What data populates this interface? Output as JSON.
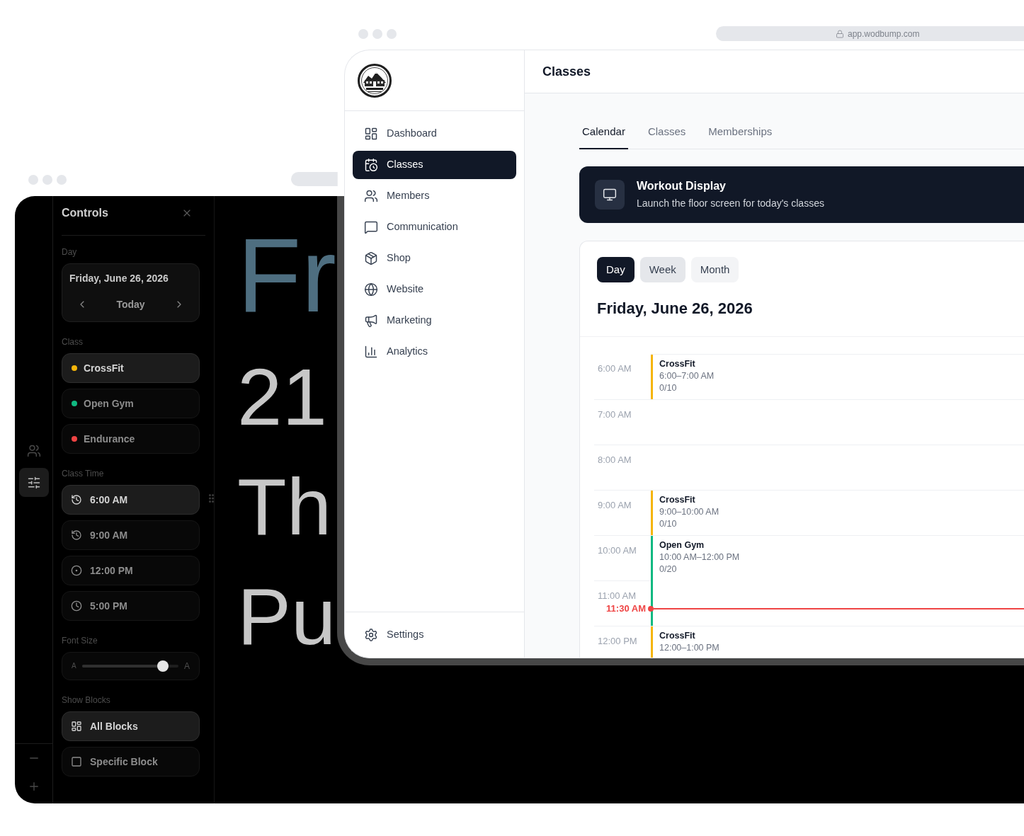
{
  "back_window": {
    "rail_tabs": [
      {
        "selected": false
      },
      {
        "selected": true
      }
    ],
    "controls": {
      "title": "Controls",
      "day": {
        "label": "Day",
        "date": "Friday, June 26, 2026",
        "today": "Today"
      },
      "class": {
        "label": "Class",
        "options": [
          {
            "name": "CrossFit",
            "color": "#f5b50a",
            "selected": true
          },
          {
            "name": "Open Gym",
            "color": "#10b981",
            "selected": false
          },
          {
            "name": "Endurance",
            "color": "#ef4444",
            "selected": false
          }
        ]
      },
      "class_time": {
        "label": "Class Time",
        "options": [
          {
            "time": "6:00 AM",
            "selected": true
          },
          {
            "time": "9:00 AM",
            "selected": false
          },
          {
            "time": "12:00 PM",
            "selected": false
          },
          {
            "time": "5:00 PM",
            "selected": false
          }
        ]
      },
      "font_size": {
        "label": "Font Size",
        "min_label": "A",
        "max_label": "A",
        "level": 0.84
      },
      "show_blocks": {
        "label": "Show Blocks",
        "options": [
          {
            "label": "All Blocks",
            "selected": true
          },
          {
            "label": "Specific Block",
            "selected": false
          }
        ]
      }
    },
    "display": {
      "lines": [
        {
          "kind": "heading",
          "text": "Fr"
        },
        {
          "kind": "body",
          "text": "21"
        },
        {
          "kind": "body",
          "text": "Th"
        },
        {
          "kind": "body",
          "text": "Pu"
        }
      ]
    }
  },
  "front_window": {
    "address": "app.wodbump.com",
    "sidebar": {
      "items": [
        {
          "label": "Dashboard",
          "selected": false
        },
        {
          "label": "Classes",
          "selected": true
        },
        {
          "label": "Members",
          "selected": false
        },
        {
          "label": "Communication",
          "selected": false
        },
        {
          "label": "Shop",
          "selected": false
        },
        {
          "label": "Website",
          "selected": false
        },
        {
          "label": "Marketing",
          "selected": false
        },
        {
          "label": "Analytics",
          "selected": false
        }
      ],
      "footer": {
        "label": "Settings"
      }
    },
    "header": {
      "title": "Classes"
    },
    "tabs": [
      {
        "label": "Calendar",
        "selected": true
      },
      {
        "label": "Classes",
        "selected": false
      },
      {
        "label": "Memberships",
        "selected": false
      }
    ],
    "banner": {
      "title": "Workout Display",
      "subtitle": "Launch the floor screen for today's classes"
    },
    "calendar": {
      "views": [
        {
          "label": "Day",
          "selected": true,
          "hovered": false
        },
        {
          "label": "Week",
          "selected": false,
          "hovered": true
        },
        {
          "label": "Month",
          "selected": false,
          "hovered": false
        }
      ],
      "date": "Friday, June 26, 2026",
      "hours": [
        {
          "label": "6:00 AM",
          "event": {
            "title": "CrossFit",
            "time": "6:00–7:00 AM",
            "capacity": "0/10",
            "color": "#f5b50a"
          }
        },
        {
          "label": "7:00 AM"
        },
        {
          "label": "8:00 AM"
        },
        {
          "label": "9:00 AM",
          "event": {
            "title": "CrossFit",
            "time": "9:00–10:00 AM",
            "capacity": "0/10",
            "color": "#f5b50a"
          }
        },
        {
          "label": "10:00 AM",
          "event": {
            "title": "Open Gym",
            "time": "10:00 AM–12:00 PM",
            "capacity": "0/20",
            "color": "#10b981",
            "also_covers": [
              {
                "label": "11:00 AM",
                "now": "11:30 AM"
              }
            ]
          }
        },
        {
          "label": "12:00 PM",
          "event": {
            "title": "CrossFit",
            "time": "12:00–1:00 PM",
            "color": "#f5b50a"
          }
        }
      ]
    }
  }
}
